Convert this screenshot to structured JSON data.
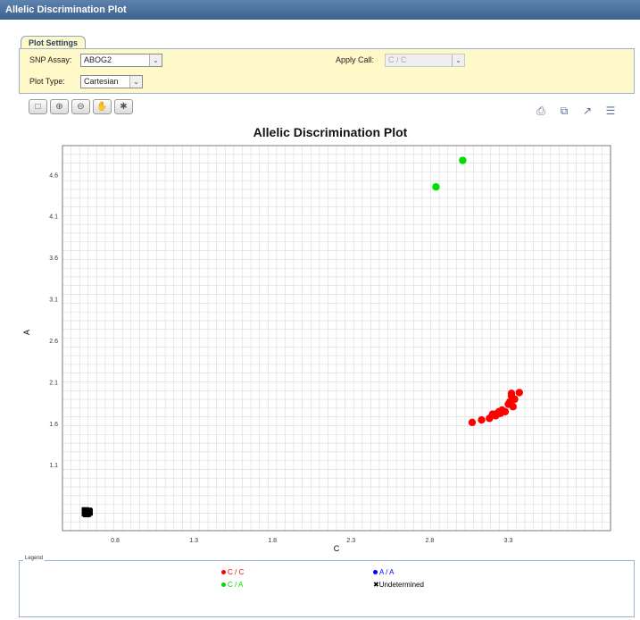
{
  "window": {
    "title": "Allelic Discrimination Plot"
  },
  "plot_settings": {
    "tab_label": "Plot Settings",
    "snp_assay_label": "SNP Assay:",
    "snp_assay_value": "ABOG2",
    "apply_call_label": "Apply Call:",
    "apply_call_value": "C / C",
    "plot_type_label": "Plot Type:",
    "plot_type_value": "Cartesian"
  },
  "toolbar": {
    "left_icons": [
      "select-icon",
      "zoom-in-icon",
      "zoom-out-icon",
      "pan-hand-icon",
      "lasso-icon"
    ],
    "right_icons": [
      "print-icon",
      "copy-icon",
      "chart-icon",
      "list-icon"
    ]
  },
  "chart_data": {
    "type": "scatter",
    "title": "Allelic Discrimination Plot",
    "xlabel": "C",
    "ylabel": "A",
    "x_ticks": [
      "0.8",
      "1.3",
      "1.8",
      "2.3",
      "2.8",
      "3.3"
    ],
    "y_ticks": [
      "1.1",
      "1.6",
      "2.1",
      "2.6",
      "3.1",
      "3.6",
      "4.1",
      "4.6"
    ],
    "xlim": [
      0.465,
      3.95
    ],
    "ylim": [
      0.305,
      4.948
    ],
    "grid": true,
    "series": [
      {
        "name": "C / C",
        "color": "#ff0000",
        "marker": "circle",
        "points": [
          [
            3.07,
            1.61
          ],
          [
            3.13,
            1.64
          ],
          [
            3.18,
            1.66
          ],
          [
            3.2,
            1.71
          ],
          [
            3.22,
            1.69
          ],
          [
            3.23,
            1.72
          ],
          [
            3.24,
            1.74
          ],
          [
            3.25,
            1.72
          ],
          [
            3.26,
            1.76
          ],
          [
            3.28,
            1.74
          ],
          [
            3.3,
            1.83
          ],
          [
            3.31,
            1.86
          ],
          [
            3.32,
            1.93
          ],
          [
            3.32,
            1.96
          ],
          [
            3.33,
            1.8
          ],
          [
            3.34,
            1.89
          ],
          [
            3.37,
            1.97
          ]
        ]
      },
      {
        "name": "C / A",
        "color": "#00dd00",
        "marker": "circle",
        "points": [
          [
            2.84,
            4.45
          ],
          [
            3.01,
            4.77
          ]
        ]
      },
      {
        "name": "A / A",
        "color": "#0000ff",
        "marker": "circle",
        "points": []
      },
      {
        "name": "Undetermined",
        "color": "#000000",
        "marker": "x",
        "points": [
          [
            0.61,
            0.52
          ],
          [
            0.615,
            0.535
          ],
          [
            0.62,
            0.525
          ],
          [
            0.63,
            0.54
          ],
          [
            0.625,
            0.515
          ],
          [
            0.61,
            0.545
          ],
          [
            0.635,
            0.53
          ],
          [
            0.618,
            0.51
          ]
        ]
      }
    ],
    "legend_title": "Legend",
    "legend_placement": "bottom"
  }
}
